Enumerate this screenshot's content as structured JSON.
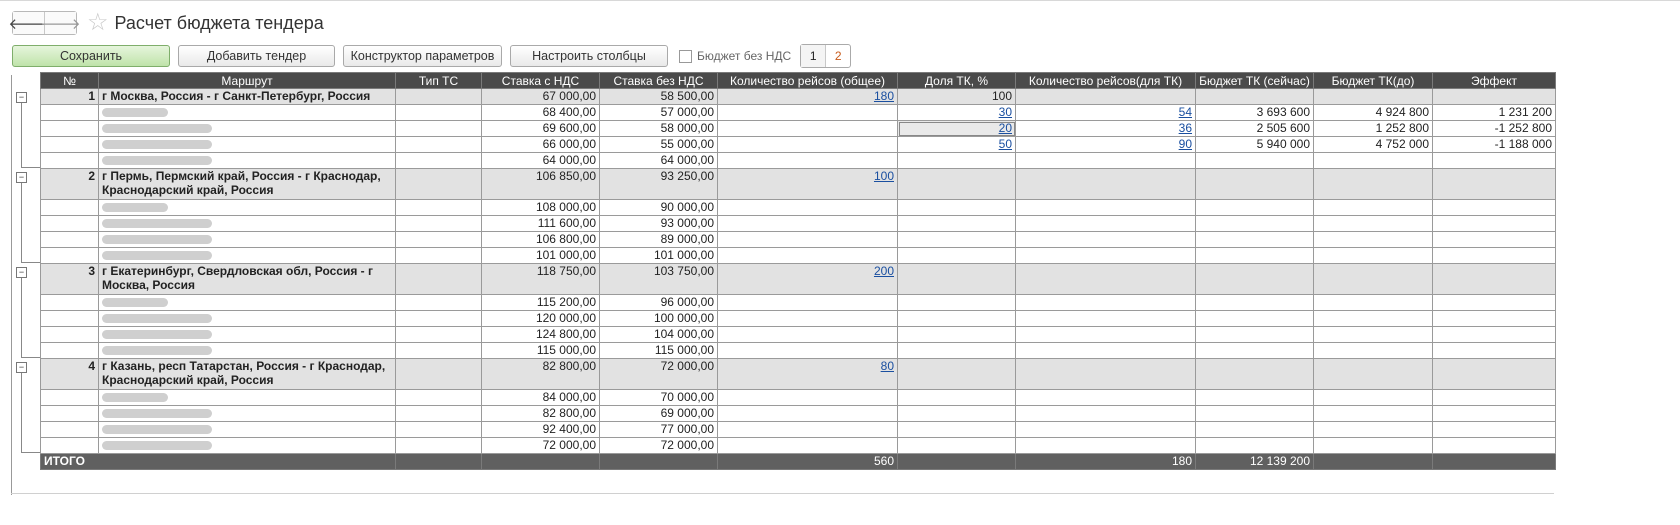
{
  "window": {
    "title": "Расчет бюджета тендера"
  },
  "nav": {
    "back_icon": "arrow-left-icon",
    "forward_icon": "arrow-right-icon",
    "favorite_icon": "star-icon"
  },
  "toolbar": {
    "save_label": "Сохранить",
    "add_label": "Добавить тендер",
    "constructor_label": "Конструктор параметров",
    "columns_label": "Настроить столбцы",
    "checkbox_label": "Бюджет без НДС",
    "pages": [
      "1",
      "2"
    ]
  },
  "columns": [
    "№",
    "Маршрут",
    "Тип ТС",
    "Ставка с НДС",
    "Ставка без НДС",
    "Количество рейсов (общее)",
    "Доля ТК, %",
    "Количество рейсов(для ТК)",
    "Бюджет ТК (сейчас)",
    "Бюджет ТК(до)",
    "Эффект"
  ],
  "groups": [
    {
      "num": "1",
      "route": "г Москва, Россия - г Санкт-Петербург, Россия",
      "rate_vat": "67 000,00",
      "rate_novat": "58 500,00",
      "trips_total": "180",
      "share": "100",
      "rows": [
        {
          "rate_vat": "68 400,00",
          "rate_novat": "57 000,00",
          "share": "30",
          "trips_tk": "54",
          "budget_now": "3 693 600",
          "budget_before": "4 924 800",
          "effect": "1 231 200",
          "effect_sign": "pos"
        },
        {
          "rate_vat": "69 600,00",
          "rate_novat": "58 000,00",
          "share": "20",
          "trips_tk": "36",
          "budget_now": "2 505 600",
          "budget_before": "1 252 800",
          "effect": "-1 252 800",
          "effect_sign": "neg"
        },
        {
          "rate_vat": "66 000,00",
          "rate_novat": "55 000,00",
          "share": "50",
          "trips_tk": "90",
          "budget_now": "5 940 000",
          "budget_before": "4 752 000",
          "effect": "-1 188 000",
          "effect_sign": "neg"
        },
        {
          "rate_vat": "64 000,00",
          "rate_novat": "64 000,00"
        }
      ]
    },
    {
      "num": "2",
      "route": "г Пермь, Пермский край, Россия - г Краснодар, Краснодарский край, Россия",
      "rate_vat": "106 850,00",
      "rate_novat": "93 250,00",
      "trips_total": "100",
      "rows": [
        {
          "rate_vat": "108 000,00",
          "rate_novat": "90 000,00"
        },
        {
          "rate_vat": "111 600,00",
          "rate_novat": "93 000,00"
        },
        {
          "rate_vat": "106 800,00",
          "rate_novat": "89 000,00"
        },
        {
          "rate_vat": "101 000,00",
          "rate_novat": "101 000,00"
        }
      ]
    },
    {
      "num": "3",
      "route": "г Екатеринбург, Свердловская обл, Россия - г Москва, Россия",
      "rate_vat": "118 750,00",
      "rate_novat": "103 750,00",
      "trips_total": "200",
      "rows": [
        {
          "rate_vat": "115 200,00",
          "rate_novat": "96 000,00"
        },
        {
          "rate_vat": "120 000,00",
          "rate_novat": "100 000,00"
        },
        {
          "rate_vat": "124 800,00",
          "rate_novat": "104 000,00"
        },
        {
          "rate_vat": "115 000,00",
          "rate_novat": "115 000,00"
        }
      ]
    },
    {
      "num": "4",
      "route": "г Казань, респ Татарстан, Россия - г Краснодар, Краснодарский край, Россия",
      "rate_vat": "82 800,00",
      "rate_novat": "72 000,00",
      "trips_total": "80",
      "rows": [
        {
          "rate_vat": "84 000,00",
          "rate_novat": "70 000,00"
        },
        {
          "rate_vat": "82 800,00",
          "rate_novat": "69 000,00"
        },
        {
          "rate_vat": "92 400,00",
          "rate_novat": "77 000,00"
        },
        {
          "rate_vat": "72 000,00",
          "rate_novat": "72 000,00"
        }
      ]
    }
  ],
  "total": {
    "label": "ИТОГО",
    "trips_total": "560",
    "trips_tk": "180",
    "budget_now": "12 139 200"
  },
  "colors": {
    "save_button": "#bfe3aa",
    "header_bg": "#4a4a4a",
    "group_bg": "#e2e2e2",
    "positive": "#2a8a2a",
    "negative": "#d01616",
    "link": "#1a4fa0"
  }
}
